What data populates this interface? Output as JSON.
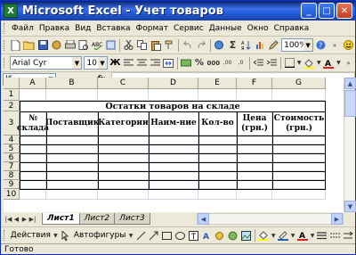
{
  "title": {
    "app_name": "Microsoft Excel - Учет товаров",
    "app_icon_letter": "X"
  },
  "window_buttons": [
    {
      "name": "minimize",
      "glyph": "_"
    },
    {
      "name": "maximize",
      "glyph": "□"
    },
    {
      "name": "close",
      "glyph": "✕"
    }
  ],
  "menu": [
    "Файл",
    "Правка",
    "Вид",
    "Вставка",
    "Формат",
    "Сервис",
    "Данные",
    "Окно",
    "Справка"
  ],
  "toolbar": {
    "zoom": "100%",
    "sum_glyph": "Σ"
  },
  "format_toolbar": {
    "font": "Arial Cyr",
    "size": "10",
    "bold": "Ж",
    "italic": "К",
    "underline": "Ч"
  },
  "formula_bar": {
    "name_box": "I6",
    "fx": "fx"
  },
  "columns": [
    "A",
    "B",
    "C",
    "D",
    "E",
    "F",
    "G"
  ],
  "rows": [
    "1",
    "2",
    "3",
    "4",
    "5",
    "6",
    "7",
    "8",
    "9",
    "10"
  ],
  "sheet": {
    "title": "Остатки товаров на складе",
    "headers": [
      "№ склада",
      "Поставщик",
      "Категории",
      "Наим-ние",
      "Кол-во",
      "Цена (грн.)",
      "Стоимость (грн.)"
    ]
  },
  "sheet_tabs": [
    "Лист1",
    "Лист2",
    "Лист3"
  ],
  "draw_toolbar": {
    "actions": "Действия",
    "autoshapes": "Автофигуры"
  },
  "status": "Готово"
}
